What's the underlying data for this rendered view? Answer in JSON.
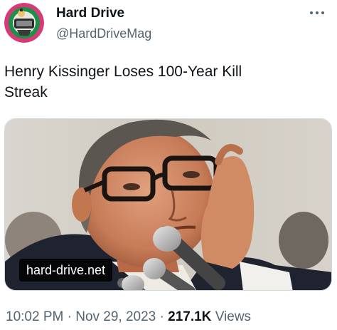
{
  "author": {
    "name": "Hard Drive",
    "handle": "@HardDriveMag",
    "avatar_icon": "hard-drive-logo-avatar"
  },
  "tweet": {
    "line1": "Henry Kissinger Loses 100-Year Kill",
    "line2": "Streak"
  },
  "media": {
    "watermark": "hard-drive.net",
    "description_icon": "photo-man-with-glasses-at-microphones"
  },
  "meta": {
    "time": "10:02 PM",
    "separator": " · ",
    "date": "Nov 29, 2023",
    "views_count": "217.1K",
    "views_label": " Views"
  },
  "colors": {
    "text": "#0f1419",
    "secondary": "#536471",
    "avatar_bg": "#d63b78"
  }
}
